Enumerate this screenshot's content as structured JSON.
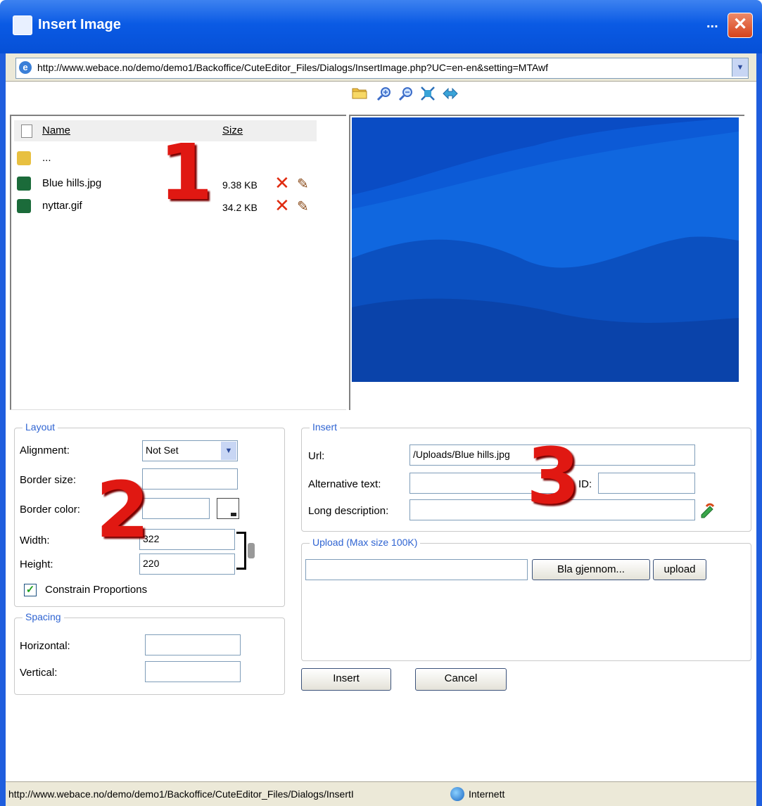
{
  "window": {
    "title": "Insert Image",
    "ellipsis": "...",
    "close": "✕"
  },
  "address": {
    "url": "http://www.webace.no/demo/demo1/Backoffice/CuteEditor_Files/Dialogs/InsertImage.php?UC=en-en&setting=MTAwf"
  },
  "toolbar": {
    "icons": [
      "new-folder-icon",
      "zoom-in-icon",
      "zoom-out-icon",
      "actual-size-icon",
      "fit-icon"
    ]
  },
  "file_browser": {
    "columns": {
      "name": "Name",
      "size": "Size"
    },
    "parent_label": "...",
    "files": [
      {
        "name": "Blue hills.jpg",
        "size": "9.38 KB"
      },
      {
        "name": "nyttar.gif",
        "size": "34.2 KB"
      }
    ]
  },
  "markers": {
    "one": "1",
    "two": "2",
    "three": "3"
  },
  "layout": {
    "legend": "Layout",
    "alignment_label": "Alignment:",
    "alignment_value": "Not Set",
    "border_size_label": "Border size:",
    "border_size_value": "",
    "border_color_label": "Border color:",
    "border_color_value": "",
    "width_label": "Width:",
    "width_value": "322",
    "height_label": "Height:",
    "height_value": "220",
    "constrain_label": "Constrain Proportions",
    "constrain_checked": true
  },
  "spacing": {
    "legend": "Spacing",
    "horizontal_label": "Horizontal:",
    "horizontal_value": "",
    "vertical_label": "Vertical:",
    "vertical_value": ""
  },
  "insert": {
    "legend": "Insert",
    "url_label": "Url:",
    "url_value": "/Uploads/Blue hills.jpg",
    "alt_label": "Alternative text:",
    "alt_value": "",
    "id_label": "ID:",
    "id_value": "",
    "longdesc_label": "Long description:",
    "longdesc_value": ""
  },
  "upload": {
    "legend": "Upload (Max size 100K)",
    "file_value": "",
    "browse_label": "Bla gjennom...",
    "upload_label": "upload"
  },
  "actions": {
    "insert_label": "Insert",
    "cancel_label": "Cancel"
  },
  "status": {
    "text": "http://www.webace.no/demo/demo1/Backoffice/CuteEditor_Files/Dialogs/InsertI",
    "zone": "Internett"
  },
  "colors": {
    "title_bar": "#0a5ae4",
    "legend_text": "#2f64d2",
    "marker_red": "#e01812",
    "delete_red": "#e02b10"
  }
}
